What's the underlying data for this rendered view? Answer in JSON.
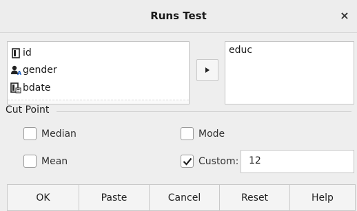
{
  "window": {
    "title": "Runs Test",
    "close_glyph": "×"
  },
  "source_variables": [
    {
      "label": "id",
      "icon": "nominal-variable-icon"
    },
    {
      "label": "gender",
      "icon": "gender-variable-icon"
    },
    {
      "label": "bdate",
      "icon": "date-variable-icon"
    }
  ],
  "move_button": {
    "icon": "arrow-right-icon"
  },
  "test_variables": [
    "educ"
  ],
  "cut_point": {
    "group_label": "Cut Point",
    "options": {
      "median": {
        "label": "Median",
        "checked": false
      },
      "mode": {
        "label": "Mode",
        "checked": false
      },
      "mean": {
        "label": "Mean",
        "checked": false
      },
      "custom": {
        "label": "Custom:",
        "checked": true,
        "value": "12"
      }
    }
  },
  "buttons": {
    "ok": "OK",
    "paste": "Paste",
    "cancel": "Cancel",
    "reset": "Reset",
    "help": "Help"
  },
  "colors": {
    "dialog_bg": "#eeeeee",
    "list_bg": "#ffffff",
    "border": "#c4c4c4"
  }
}
